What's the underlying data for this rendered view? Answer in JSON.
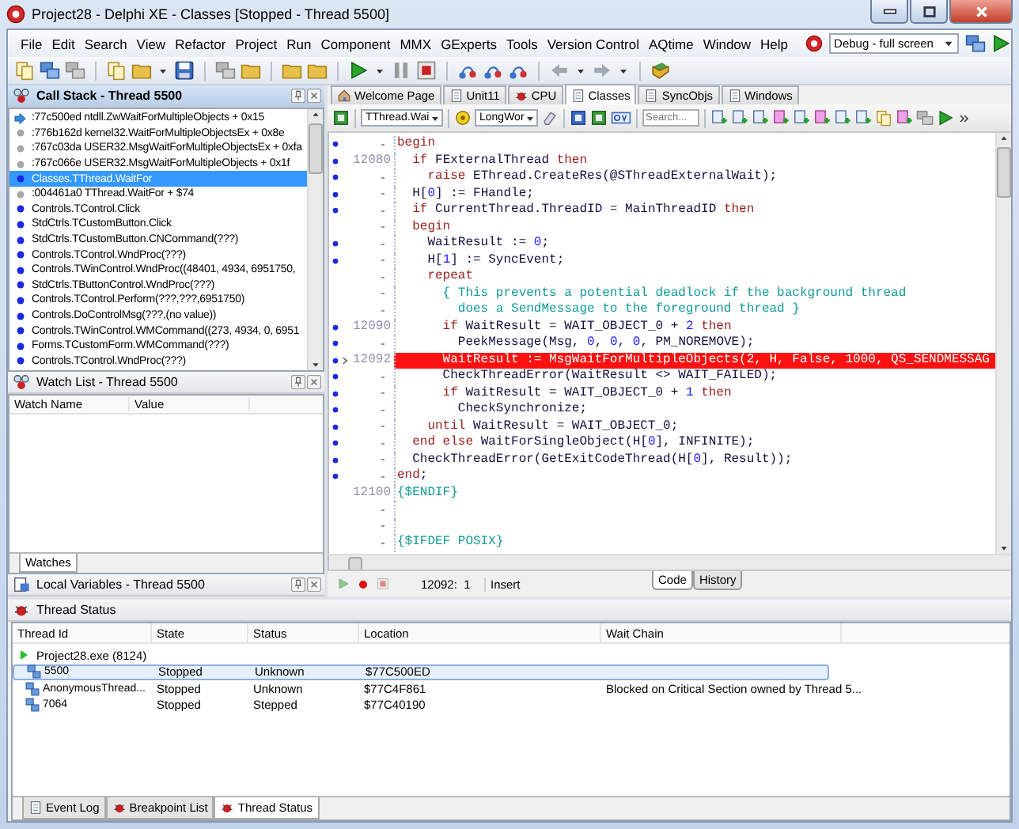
{
  "window": {
    "title": "Project28 - Delphi XE - Classes [Stopped - Thread 5500]"
  },
  "menu": [
    "File",
    "Edit",
    "Search",
    "View",
    "Refactor",
    "Project",
    "Run",
    "Component",
    "MMX",
    "GExperts",
    "Tools",
    "Version Control",
    "AQtime",
    "Window",
    "Help"
  ],
  "desktop_combo": {
    "value": "Debug - full screen"
  },
  "call_stack": {
    "title": "Call Stack - Thread 5500",
    "active": true,
    "frames": [
      {
        "text": ":77c500ed ntdll.ZwWaitForMultipleObjects + 0x15",
        "kind": "current",
        "selected": false
      },
      {
        "text": ":776b162d kernel32.WaitForMultipleObjectsEx + 0x8e",
        "kind": "nodebug",
        "selected": false
      },
      {
        "text": ":767c03da USER32.MsgWaitForMultipleObjectsEx + 0xfa",
        "kind": "nodebug",
        "selected": false
      },
      {
        "text": ":767c066e USER32.MsgWaitForMultipleObjects + 0x1f",
        "kind": "nodebug",
        "selected": false
      },
      {
        "text": "Classes.TThread.WaitFor",
        "kind": "debug",
        "selected": true
      },
      {
        "text": ":004461a0 TThread.WaitFor + $74",
        "kind": "nodebug",
        "selected": false
      },
      {
        "text": "Controls.TControl.Click",
        "kind": "debug",
        "selected": false
      },
      {
        "text": "StdCtrls.TCustomButton.Click",
        "kind": "debug",
        "selected": false
      },
      {
        "text": "StdCtrls.TCustomButton.CNCommand(???)",
        "kind": "debug",
        "selected": false
      },
      {
        "text": "Controls.TControl.WndProc(???)",
        "kind": "debug",
        "selected": false
      },
      {
        "text": "Controls.TWinControl.WndProc((48401, 4934, 6951750,",
        "kind": "debug",
        "selected": false
      },
      {
        "text": "StdCtrls.TButtonControl.WndProc(???)",
        "kind": "debug",
        "selected": false
      },
      {
        "text": "Controls.TControl.Perform(???,???,6951750)",
        "kind": "debug",
        "selected": false
      },
      {
        "text": "Controls.DoControlMsg(???,(no value))",
        "kind": "debug",
        "selected": false
      },
      {
        "text": "Controls.TWinControl.WMCommand((273, 4934, 0, 6951",
        "kind": "debug",
        "selected": false
      },
      {
        "text": "Forms.TCustomForm.WMCommand(???)",
        "kind": "debug",
        "selected": false
      },
      {
        "text": "Controls.TControl.WndProc(???)",
        "kind": "debug",
        "selected": false
      }
    ]
  },
  "watch_list": {
    "title": "Watch List - Thread 5500",
    "active": false,
    "columns": [
      "Watch Name",
      "Value"
    ],
    "tabs": [
      {
        "label": "Watches",
        "selected": true
      }
    ]
  },
  "local_variables": {
    "title": "Local Variables - Thread 5500",
    "active": false
  },
  "editor": {
    "tabs": [
      {
        "label": "Welcome Page",
        "selected": false
      },
      {
        "label": "Unit11",
        "selected": false
      },
      {
        "label": "CPU",
        "selected": false
      },
      {
        "label": "Classes",
        "selected": true
      },
      {
        "label": "SyncObjs",
        "selected": false
      },
      {
        "label": "Windows",
        "selected": false
      }
    ],
    "method_combo": {
      "value": "TThread.Wai"
    },
    "type_combo": {
      "value": "LongWor"
    },
    "search": {
      "placeholder": "Search..."
    },
    "lines": [
      {
        "executable": true,
        "current": false,
        "segments": [
          {
            "kind": "keyword",
            "text": "begin"
          }
        ]
      },
      {
        "number": "12080",
        "executable": true,
        "current": false,
        "segments": [
          {
            "kind": "keyword",
            "text": "  if "
          },
          {
            "kind": "plain",
            "text": "FExternalThread "
          },
          {
            "kind": "keyword",
            "text": "then"
          }
        ]
      },
      {
        "executable": true,
        "current": false,
        "segments": [
          {
            "kind": "keyword",
            "text": "    raise "
          },
          {
            "kind": "plain",
            "text": "EThread.CreateRes(@SThreadExternalWait);"
          }
        ]
      },
      {
        "executable": true,
        "current": false,
        "segments": [
          {
            "kind": "plain",
            "text": "  H["
          },
          {
            "kind": "number",
            "text": "0"
          },
          {
            "kind": "plain",
            "text": "] := FHandle;"
          }
        ]
      },
      {
        "executable": true,
        "current": false,
        "segments": [
          {
            "kind": "keyword",
            "text": "  if "
          },
          {
            "kind": "plain",
            "text": "CurrentThread.ThreadID = MainThreadID "
          },
          {
            "kind": "keyword",
            "text": "then"
          }
        ]
      },
      {
        "executable": false,
        "current": false,
        "segments": [
          {
            "kind": "keyword",
            "text": "  begin"
          }
        ]
      },
      {
        "executable": true,
        "current": false,
        "segments": [
          {
            "kind": "plain",
            "text": "    WaitResult := "
          },
          {
            "kind": "number",
            "text": "0"
          },
          {
            "kind": "plain",
            "text": ";"
          }
        ]
      },
      {
        "executable": true,
        "current": false,
        "segments": [
          {
            "kind": "plain",
            "text": "    H["
          },
          {
            "kind": "number",
            "text": "1"
          },
          {
            "kind": "plain",
            "text": "] := SyncEvent;"
          }
        ]
      },
      {
        "executable": false,
        "current": false,
        "segments": [
          {
            "kind": "keyword",
            "text": "    repeat"
          }
        ]
      },
      {
        "executable": false,
        "current": false,
        "segments": [
          {
            "kind": "comment",
            "text": "      { This prevents a potential deadlock if the background thread"
          }
        ]
      },
      {
        "executable": false,
        "current": false,
        "segments": [
          {
            "kind": "comment",
            "text": "        does a SendMessage to the foreground thread }"
          }
        ]
      },
      {
        "number": "12090",
        "executable": true,
        "current": false,
        "segments": [
          {
            "kind": "keyword",
            "text": "      if "
          },
          {
            "kind": "plain",
            "text": "WaitResult = WAIT_OBJECT_0 + "
          },
          {
            "kind": "number",
            "text": "2"
          },
          {
            "kind": "keyword",
            "text": " then"
          }
        ]
      },
      {
        "executable": true,
        "current": false,
        "segments": [
          {
            "kind": "plain",
            "text": "        PeekMessage(Msg, "
          },
          {
            "kind": "number",
            "text": "0"
          },
          {
            "kind": "plain",
            "text": ", "
          },
          {
            "kind": "number",
            "text": "0"
          },
          {
            "kind": "plain",
            "text": ", "
          },
          {
            "kind": "number",
            "text": "0"
          },
          {
            "kind": "plain",
            "text": ", PM_NOREMOVE);"
          }
        ]
      },
      {
        "number": "12092",
        "executable": true,
        "current": true,
        "segments": [
          {
            "kind": "plain",
            "text": "      WaitResult := MsgWaitForMultipleObjects(2, H, False, 1000, QS_SENDMESSAG"
          }
        ]
      },
      {
        "executable": true,
        "current": false,
        "segments": [
          {
            "kind": "plain",
            "text": "      CheckThreadError(WaitResult <> WAIT_FAILED);"
          }
        ]
      },
      {
        "executable": true,
        "current": false,
        "segments": [
          {
            "kind": "keyword",
            "text": "      if "
          },
          {
            "kind": "plain",
            "text": "WaitResult = WAIT_OBJECT_0 + "
          },
          {
            "kind": "number",
            "text": "1"
          },
          {
            "kind": "keyword",
            "text": " then"
          }
        ]
      },
      {
        "executable": true,
        "current": false,
        "segments": [
          {
            "kind": "plain",
            "text": "        CheckSynchronize;"
          }
        ]
      },
      {
        "executable": true,
        "current": false,
        "segments": [
          {
            "kind": "keyword",
            "text": "    until "
          },
          {
            "kind": "plain",
            "text": "WaitResult = WAIT_OBJECT_0;"
          }
        ]
      },
      {
        "executable": true,
        "current": false,
        "segments": [
          {
            "kind": "keyword",
            "text": "  end else "
          },
          {
            "kind": "plain",
            "text": "WaitForSingleObject(H["
          },
          {
            "kind": "number",
            "text": "0"
          },
          {
            "kind": "plain",
            "text": "], INFINITE);"
          }
        ]
      },
      {
        "executable": true,
        "current": false,
        "segments": [
          {
            "kind": "plain",
            "text": "  CheckThreadError(GetExitCodeThread(H["
          },
          {
            "kind": "number",
            "text": "0"
          },
          {
            "kind": "plain",
            "text": "], Result));"
          }
        ]
      },
      {
        "executable": true,
        "current": false,
        "segments": [
          {
            "kind": "keyword",
            "text": "end"
          },
          {
            "kind": "plain",
            "text": ";"
          }
        ]
      },
      {
        "number": "12100",
        "executable": false,
        "current": false,
        "segments": [
          {
            "kind": "comment",
            "text": "{$ENDIF}"
          }
        ]
      },
      {
        "executable": false,
        "current": false
      },
      {
        "executable": false,
        "current": false
      },
      {
        "executable": false,
        "current": false,
        "segments": [
          {
            "kind": "comment",
            "text": "{$IFDEF POSIX}"
          }
        ]
      }
    ],
    "status": {
      "position": "12092:  1",
      "mode": "Insert"
    },
    "view_tabs": [
      {
        "label": "Code",
        "selected": true
      },
      {
        "label": "History",
        "selected": false
      }
    ]
  },
  "thread_status": {
    "title": "Thread Status",
    "columns": [
      "Thread Id",
      "State",
      "Status",
      "Location",
      "Wait Chain"
    ],
    "processes": [
      {
        "name": "Project28.exe (8124)",
        "expanded": true,
        "children": [
          {
            "cells": [
              "5500",
              "Stopped",
              "Unknown",
              "$77C500ED"
            ],
            "selected": true
          },
          {
            "cells": [
              "AnonymousThread...",
              "Stopped",
              "Unknown",
              "$77C4F861",
              "Blocked on Critical Section owned by Thread 5..."
            ],
            "selected": false
          },
          {
            "cells": [
              "7064",
              "Stopped",
              "Stepped",
              "$77C40190"
            ],
            "selected": false
          }
        ]
      }
    ]
  },
  "bottom_tabs": [
    {
      "label": "Event Log",
      "selected": false
    },
    {
      "label": "Breakpoint List",
      "selected": false
    },
    {
      "label": "Thread Status",
      "selected": true
    }
  ]
}
